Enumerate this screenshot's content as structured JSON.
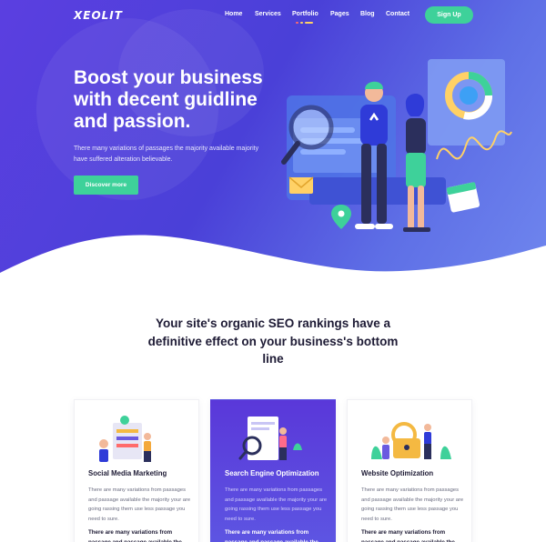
{
  "brand": {
    "logo": "XEOLIT"
  },
  "nav": {
    "items": [
      "Home",
      "Services",
      "Portfolio",
      "Pages",
      "Blog",
      "Contact"
    ],
    "active": "Portfolio",
    "signup_label": "Sign Up"
  },
  "hero": {
    "title": "Boost your business with decent guidline and passion.",
    "description": "There many variations of passages the majority available majority have suffered alteration  believable.",
    "cta_label": "Discover more"
  },
  "section": {
    "title": "Your site's organic SEO rankings have a definitive effect on your business's bottom line"
  },
  "cards": [
    {
      "title": "Social Media Marketing",
      "text": "There are many variations from passages and passage available the majority your are going rassing them use less passage you need to sure.",
      "bold_text": "There are many variations from passage and passage available the majority",
      "active": false
    },
    {
      "title": "Search Engine Optimization",
      "text": "There are many variations from passages and passage available the majority your are going rassing them use less passage you need to sure.",
      "bold_text": "There are many variations from passage and passage available the majority",
      "active": true
    },
    {
      "title": "Website Optimization",
      "text": "There are many variations from passages and passage available the majority your are going rassing them use less passage you need to sure.",
      "bold_text": "There are many variations from passage and passage available the majority",
      "active": false
    }
  ],
  "colors": {
    "hero_start": "#5b3fe0",
    "hero_end": "#6f86ee",
    "accent_green": "#3ed19a",
    "heading_dark": "#1e1b35",
    "active_card": "#5a38d9"
  },
  "icons": [
    "magnifier-icon",
    "chart-icon",
    "calendar-icon",
    "map-pin-icon",
    "envelope-icon"
  ]
}
